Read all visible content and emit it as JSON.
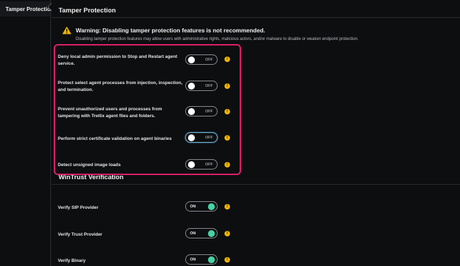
{
  "nav": {
    "items": [
      {
        "label": "Tamper Protection"
      }
    ]
  },
  "tamper": {
    "title": "Tamper Protection",
    "warning": {
      "title": "Warning: Disabling tamper protection features is not recommended.",
      "body": "Disabling tamper protection features may allow users with administrative rights, malicious actors, and/or malware to disable or weaken endpoint protection."
    },
    "settings": [
      {
        "label": "Deny local admin permission to Stop and Restart agent service.",
        "state": "OFF"
      },
      {
        "label": "Protect select agent processes from injection, inspection, and termination.",
        "state": "OFF"
      },
      {
        "label": "Prevent unauthorized users and processes from tampering with Trellix agent files and folders.",
        "state": "OFF"
      },
      {
        "label": "Perform strict certificate validation on agent binaries",
        "state": "OFF"
      },
      {
        "label": "Detect unsigned image loads",
        "state": "OFF"
      }
    ]
  },
  "wintrust": {
    "title": "WinTrust Verification",
    "settings": [
      {
        "label": "Verify SIP Provider",
        "state": "ON"
      },
      {
        "label": "Verify Trust Provider",
        "state": "ON"
      },
      {
        "label": "Verify Binary",
        "state": "ON"
      }
    ]
  },
  "info_icon_glyph": "!",
  "colors": {
    "accent_highlight": "#e0206a",
    "toggle_on_knob": "#46d3a5",
    "warning": "#f2b800",
    "background": "#0d0e10"
  }
}
